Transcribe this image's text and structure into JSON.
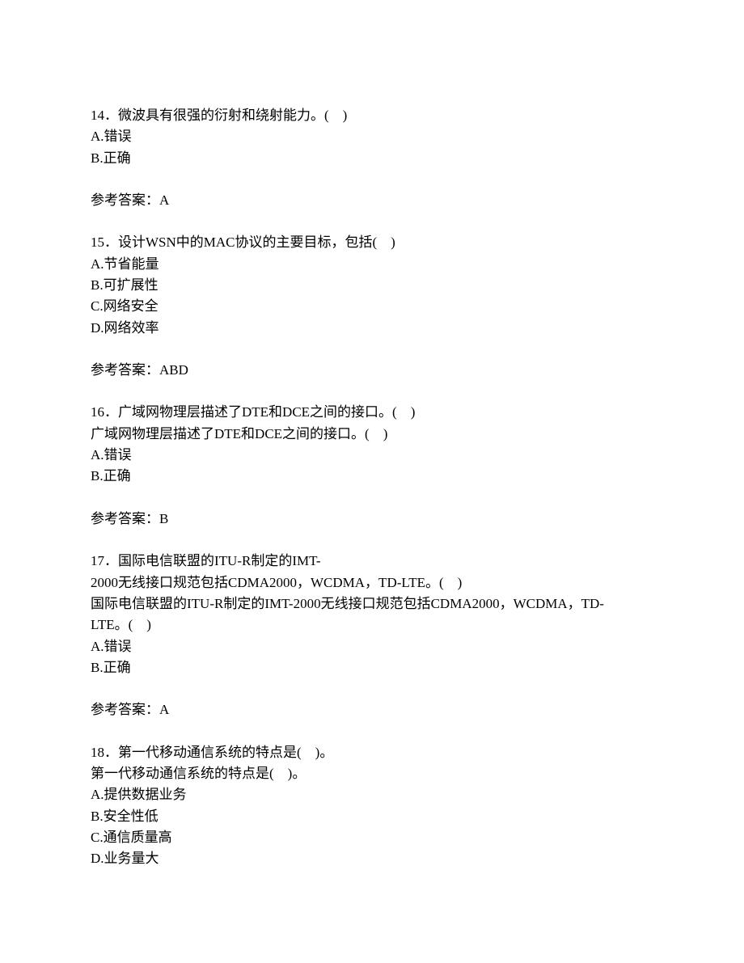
{
  "q14": {
    "title": "14．微波具有很强的衍射和绕射能力。(　)",
    "optA": "A.错误",
    "optB": "B.正确",
    "answer": "参考答案：A"
  },
  "q15": {
    "title": "15．设计WSN中的MAC协议的主要目标，包括(　)",
    "optA": "A.节省能量",
    "optB": "B.可扩展性",
    "optC": "C.网络安全",
    "optD": "D.网络效率",
    "answer": "参考答案：ABD"
  },
  "q16": {
    "title": "16．广域网物理层描述了DTE和DCE之间的接口。(　)",
    "repeat": "广域网物理层描述了DTE和DCE之间的接口。(　)",
    "optA": "A.错误",
    "optB": "B.正确",
    "answer": "参考答案：B"
  },
  "q17": {
    "title1": "17．国际电信联盟的ITU-R制定的IMT-",
    "title2": "2000无线接口规范包括CDMA2000，WCDMA，TD-LTE。(　)",
    "repeat1": "国际电信联盟的ITU-R制定的IMT-2000无线接口规范包括CDMA2000，WCDMA，TD-",
    "repeat2": "LTE。(　)",
    "optA": "A.错误",
    "optB": "B.正确",
    "answer": "参考答案：A"
  },
  "q18": {
    "title": "18．第一代移动通信系统的特点是(　)。",
    "repeat": "第一代移动通信系统的特点是(　)。",
    "optA": "A.提供数据业务",
    "optB": "B.安全性低",
    "optC": "C.通信质量高",
    "optD": "D.业务量大"
  }
}
